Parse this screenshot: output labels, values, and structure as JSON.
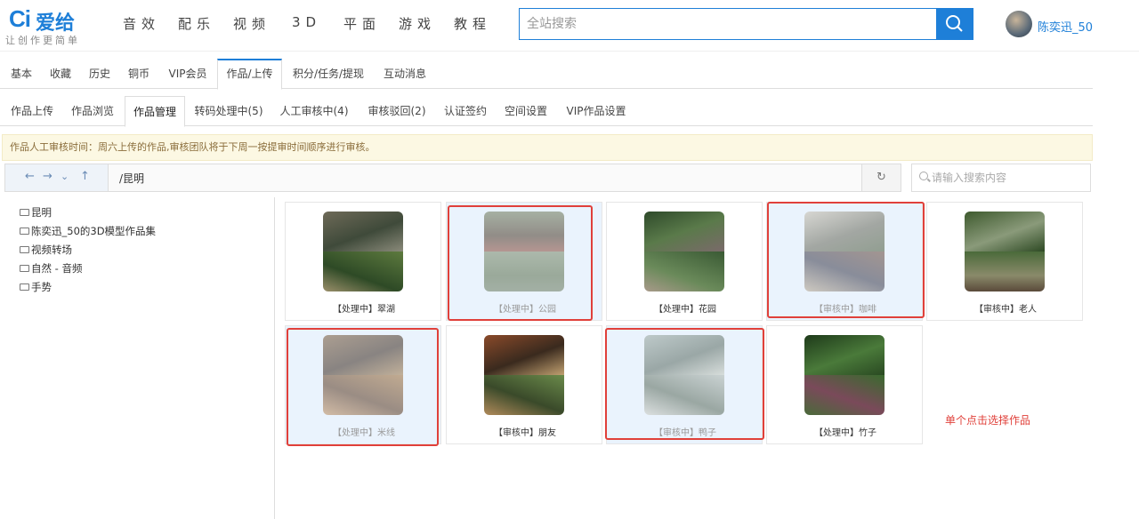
{
  "logo": {
    "mark": "Ci",
    "text": "爱给",
    "slogan": "让创作更简单"
  },
  "topnav": [
    "音效",
    "配乐",
    "视频",
    "3D",
    "平面",
    "游戏",
    "教程"
  ],
  "search": {
    "placeholder": "全站搜索",
    "icon": "search-icon"
  },
  "user": {
    "name": "陈奕迅_50"
  },
  "tabs_main": [
    "基本",
    "收藏",
    "历史",
    "铜币",
    "VIP会员",
    "作品/上传",
    "积分/任务/提现",
    "互动消息"
  ],
  "tabs_main_active": "作品/上传",
  "tabs_sub": [
    "作品上传",
    "作品浏览",
    "作品管理",
    "转码处理中(5)",
    "人工审核中(4)",
    "审核驳回(2)",
    "认证签约",
    "空间设置",
    "VIP作品设置"
  ],
  "tabs_sub_active": "作品管理",
  "notice": "作品人工审核时间：周六上传的作品,审核团队将于下周一按提审时间顺序进行审核。",
  "pathbar": {
    "path": "/昆明",
    "icons": [
      "back-arrow-icon",
      "forward-arrow-icon",
      "chevron-down-icon",
      "up-arrow-icon"
    ],
    "refresh_icon": "refresh-icon"
  },
  "search2": {
    "placeholder": "请输入搜索内容"
  },
  "tree": [
    "昆明",
    "陈奕迅_50的3D模型作品集",
    "视频转场",
    "自然 - 音频",
    "手势"
  ],
  "works": [
    {
      "caption": "【处理中】翠湖",
      "selected": false
    },
    {
      "caption": "【处理中】公园",
      "selected": true
    },
    {
      "caption": "【处理中】花园",
      "selected": false
    },
    {
      "caption": "【审核中】咖啡",
      "selected": true
    },
    {
      "caption": "【审核中】老人",
      "selected": false
    },
    {
      "caption": "【处理中】米线",
      "selected": true
    },
    {
      "caption": "【审核中】朋友",
      "selected": false
    },
    {
      "caption": "【审核中】鸭子",
      "selected": true
    },
    {
      "caption": "【处理中】竹子",
      "selected": false
    }
  ],
  "hint": "单个点击选择作品",
  "colors": {
    "accent": "#1e7fd8",
    "highlight": "#e0403a",
    "notice_bg": "#fcf8e3"
  }
}
